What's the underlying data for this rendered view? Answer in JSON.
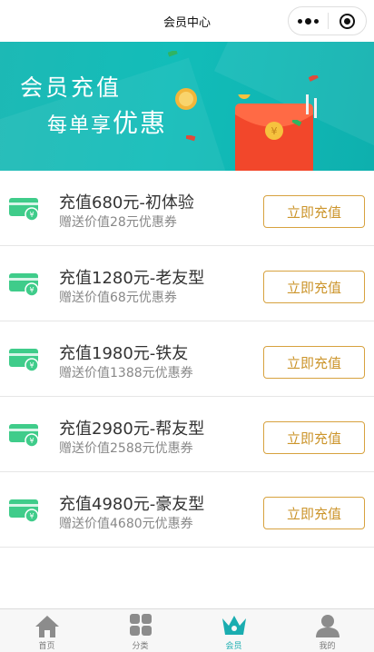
{
  "navbar": {
    "title": "会员中心"
  },
  "banner": {
    "title": "会员充值",
    "subtitle_prefix": "每单享",
    "subtitle_emphasis": "优惠"
  },
  "packages": [
    {
      "title": "充值680元-初体验",
      "desc": "赠送价值28元优惠券",
      "button": "立即充值"
    },
    {
      "title": "充值1280元-老友型",
      "desc": "赠送价值68元优惠券",
      "button": "立即充值"
    },
    {
      "title": "充值1980元-铁友",
      "desc": "赠送价值1388元优惠券",
      "button": "立即充值"
    },
    {
      "title": "充值2980元-帮友型",
      "desc": "赠送价值2588元优惠券",
      "button": "立即充值"
    },
    {
      "title": "充值4980元-豪友型",
      "desc": "赠送价值4680元优惠券",
      "button": "立即充值"
    }
  ],
  "tabbar": {
    "items": [
      {
        "label": "首页",
        "icon": "home-icon"
      },
      {
        "label": "分类",
        "icon": "category-grid-icon"
      },
      {
        "label": "会员",
        "icon": "crown-icon",
        "active": true
      },
      {
        "label": "我的",
        "icon": "user-icon"
      }
    ]
  },
  "colors": {
    "accent_teal": "#1aadb0",
    "button_gold": "#cc952c",
    "card_icon_green": "#3fcc8a"
  }
}
